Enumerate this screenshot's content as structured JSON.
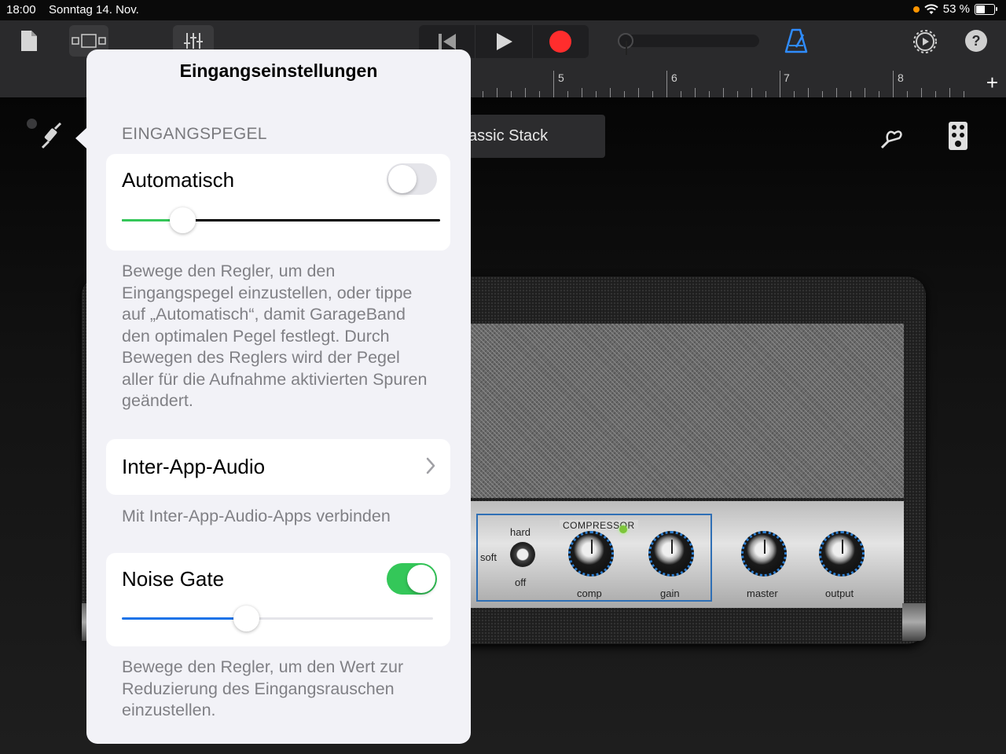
{
  "status_bar": {
    "time": "18:00",
    "date": "Sonntag 14. Nov.",
    "battery": "53 %",
    "battery_level": 0.53,
    "icons": [
      "orange-dot",
      "wifi-icon",
      "battery-icon"
    ]
  },
  "toolbar": {
    "icons": [
      "document-icon",
      "tracks-view-icon",
      "mixer-icon",
      "rewind-icon",
      "play-icon",
      "record-icon",
      "metronome-icon",
      "settings-icon",
      "help-icon"
    ],
    "help_label": "?"
  },
  "ruler": {
    "marks": [
      "5",
      "6",
      "7",
      "8"
    ],
    "add_label": "+"
  },
  "amp": {
    "preset_name": "assic Stack",
    "compressor_label": "COMPRESSOR",
    "switch_labels": {
      "hard": "hard",
      "soft": "soft",
      "off": "off"
    },
    "knobs": [
      "comp",
      "gain",
      "master",
      "output"
    ]
  },
  "popover": {
    "title": "Eingangseinstellungen",
    "section_header": "EINGANGSPEGEL",
    "automatic": {
      "label": "Automatisch",
      "on": false,
      "level": 0.19
    },
    "input_level_footnote": "Bewege den Regler, um den Eingangspegel einzustellen, oder tippe auf „Automatisch“, damit GarageBand den optimalen Pegel festlegt. Durch Bewegen des Reglers wird der Pegel aller für die Aufnahme aktivierten Spuren geändert.",
    "inter_app_audio": {
      "label": "Inter-App-Audio",
      "footnote": "Mit Inter-App-Audio-Apps verbinden"
    },
    "noise_gate": {
      "label": "Noise Gate",
      "on": true,
      "level": 0.4,
      "footnote": "Bewege den Regler, um den Wert zur Reduzierung des Eingangsrauschen einzustellen."
    }
  },
  "colors": {
    "green": "#34c759",
    "blue": "#1a73e8",
    "record_red": "#ff2d2d",
    "metronome_blue": "#2f8cff"
  }
}
